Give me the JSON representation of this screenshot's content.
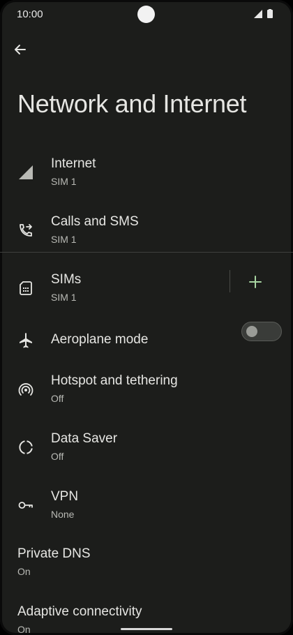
{
  "status_bar": {
    "time": "10:00"
  },
  "header": {
    "title": "Network and Internet"
  },
  "items": {
    "internet": {
      "title": "Internet",
      "subtitle": "SIM 1"
    },
    "calls": {
      "title": "Calls and SMS",
      "subtitle": "SIM 1"
    },
    "sims": {
      "title": "SIMs",
      "subtitle": "SIM 1"
    },
    "aeroplane": {
      "title": "Aeroplane mode",
      "toggle_on": false
    },
    "hotspot": {
      "title": "Hotspot and tethering",
      "subtitle": "Off"
    },
    "data_saver": {
      "title": "Data Saver",
      "subtitle": "Off"
    },
    "vpn": {
      "title": "VPN",
      "subtitle": "None"
    },
    "private_dns": {
      "title": "Private DNS",
      "subtitle": "On"
    },
    "adaptive": {
      "title": "Adaptive connectivity",
      "subtitle": "On"
    }
  },
  "icons": {
    "back": "back-arrow-icon",
    "internet": "cell-signal-icon",
    "calls": "phone-forward-icon",
    "sims": "sim-card-icon",
    "add": "plus-icon",
    "aeroplane": "airplane-icon",
    "hotspot": "hotspot-icon",
    "data_saver": "data-saver-icon",
    "vpn": "key-icon"
  },
  "colors": {
    "background": "#1c1d1b",
    "text_primary": "#e6e6e3",
    "text_secondary": "#b9bab5",
    "accent": "#a8d5a2"
  }
}
